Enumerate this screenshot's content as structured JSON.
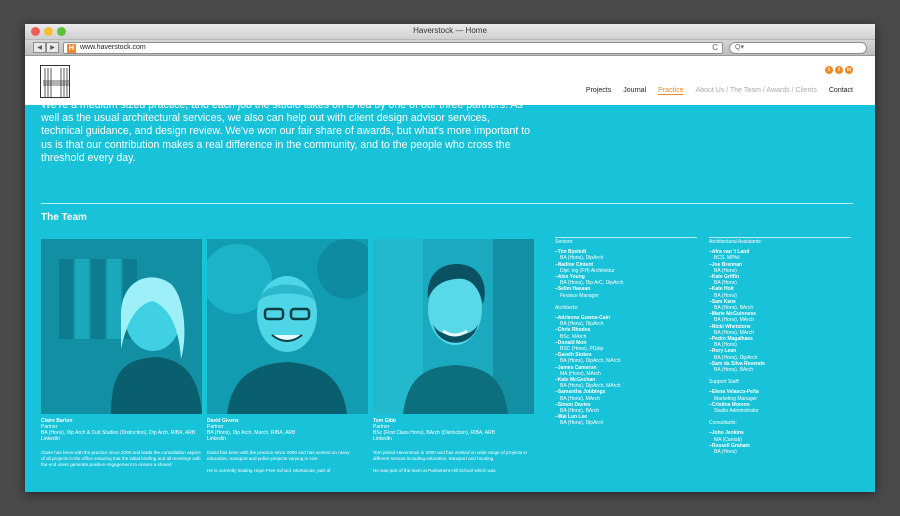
{
  "browser": {
    "title": "Haverstock — Home",
    "url": "www.haverstock.com",
    "back": "◀",
    "forward": "▶",
    "reload": "C",
    "search": "Q▾"
  },
  "header": {
    "social": [
      "t",
      "f",
      "in"
    ],
    "nav": [
      {
        "label": "Projects",
        "state": "normal"
      },
      {
        "label": "Journal",
        "state": "normal"
      },
      {
        "label": "Practice",
        "state": "active"
      },
      {
        "label": "About Us / The Team / Awards / Clients",
        "state": "dim"
      },
      {
        "label": "Contact",
        "state": "normal"
      }
    ]
  },
  "intro": "We're a medium sized practice, and each job the studio takes on is led by one of our three partners. As well as the usual architectural services, we also can help out with client design advisor services, technical guidance, and design review. We've won our fair share of awards, but what's more important to us is that our contribution makes a real difference in the community, and to the people who cross the threshold every day.",
  "team_heading": "The Team",
  "partners": [
    {
      "name": "Claire Barton",
      "role": "Partner",
      "quals": "BA (Hons), Dip Arch & Cult Studies (Distinction), Dip Arch, RIBA, ARB",
      "link": "LinkedIn",
      "bio": "Claire has been with the practice since 2000 and leads the consultation aspect of all projects in the office ensuring that the initial briefing and all meetings with the end users generate positive engagement to ensure a shared"
    },
    {
      "name": "David Givens",
      "role": "Partner",
      "quals": "BA (Hons), Dip Arch, March, RIBA, ARB",
      "link": "LinkedIn",
      "bio": "David has been with the practice since 2000 and has worked on many education, transport and police projects varying in size.",
      "bio2": "He is currently leading Hope Free School, Montacute, part of"
    },
    {
      "name": "Tom Gibb",
      "role": "Partner",
      "quals": "BSc (First Class Hons), BArch (Distinction), RIBA, ARB",
      "link": "LinkedIn",
      "bio": "Tom joined Haverstock in 2000 and has worked on wide range of projects in different sectors including education, transport and housing.",
      "bio2": "He was part of the team at Parliament Hill School which was"
    }
  ],
  "staff_col1": {
    "seniors_heading": "Seniors:",
    "seniors": [
      {
        "name": "Tim Bystedt",
        "role": "BA (Hons), DipArch"
      },
      {
        "name": "Nadine Cintent",
        "role": "Dipl. Ing (FH) Architektur"
      },
      {
        "name": "Alex Young",
        "role": "BA (Hons), Dip ArC, DipArch"
      },
      {
        "name": "Selim Hassan",
        "role": "Finance Manager"
      }
    ],
    "architects_heading": "Architects:",
    "architects": [
      {
        "name": "Adrienne Gowne-Cain",
        "role": "BA (Hons), DipArch"
      },
      {
        "name": "Chris Rhodes",
        "role": "BSc, MArch"
      },
      {
        "name": "Donald Moir",
        "role": "BSC (Hons), PGdip"
      },
      {
        "name": "Gareth Stokes",
        "role": "BA (Hons), DipArch, MArch"
      },
      {
        "name": "James Cameron",
        "role": "MA (Hons), MArch"
      },
      {
        "name": "Kate McGechan",
        "role": "BA (Hons), DipArch, MArch"
      },
      {
        "name": "Samantha Jobbings",
        "role": "BA (Hons), MArch"
      },
      {
        "name": "Simon Davies",
        "role": "BA (Hons), BArch"
      },
      {
        "name": "Wai Lun Lee",
        "role": "BA (Hons), DipArch"
      }
    ]
  },
  "staff_col2": {
    "aa_heading": "Architectural Assistants:",
    "assistants": [
      {
        "name": "Afra van 't Land",
        "role": "BCS, MPhil"
      },
      {
        "name": "Joe Brennan",
        "role": "BA (Hons)"
      },
      {
        "name": "Kate Griffin",
        "role": "BA (Hons)"
      },
      {
        "name": "Kate Holt",
        "role": "BA (Hons)"
      },
      {
        "name": "Sam Kane",
        "role": "BA (Hons), BArch"
      },
      {
        "name": "Marie McGuinness",
        "role": "BA (Hons), MArch"
      },
      {
        "name": "Nicki Whetstone",
        "role": "BA (Hons), MArch"
      },
      {
        "name": "Pedro Magalhaes",
        "role": "BA (Hons)"
      },
      {
        "name": "Rory Lean",
        "role": "BA (Hons), DipArch"
      },
      {
        "name": "Sam da Silva Resende",
        "role": "BA (Hons), BArch"
      }
    ],
    "support_heading": "Support Staff:",
    "support": [
      {
        "name": "Elena Velasco-Peña",
        "role": "Marketing Manager"
      },
      {
        "name": "Cristina Moreno",
        "role": "Studio Administrator"
      }
    ],
    "consultants_heading": "Consultants:",
    "consultants": [
      {
        "name": "John Jenkins",
        "role": "MA (Cantab)"
      },
      {
        "name": "Russell Graham",
        "role": "BA (Hons)"
      }
    ]
  },
  "colors": {
    "accent": "#f08a24",
    "background": "#18c2d9"
  }
}
